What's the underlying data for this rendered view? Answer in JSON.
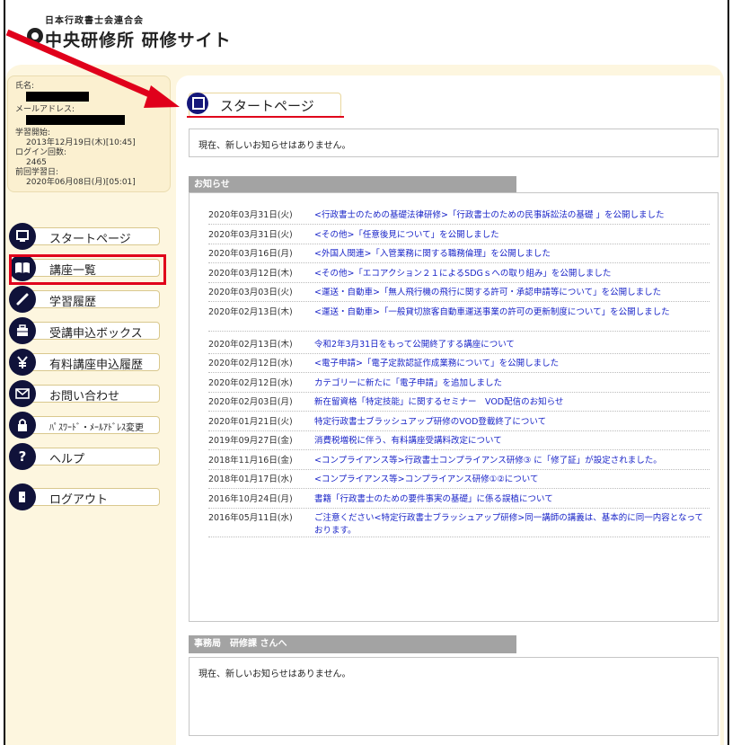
{
  "header": {
    "association": "日本行政書士会連合会",
    "site_title": "中央研修所 研修サイト"
  },
  "user": {
    "name_label": "氏名:",
    "email_label": "メールアドレス:",
    "start_label": "学習開始:",
    "start_value": "2013年12月19日(木)[10:45]",
    "login_count_label": "ログイン回数:",
    "login_count_value": "2465",
    "last_study_label": "前回学習日:",
    "last_study_value": "2020年06月08日(月)[05:01]"
  },
  "nav": [
    {
      "label": "スタートページ",
      "icon": "monitor-icon"
    },
    {
      "label": "講座一覧",
      "icon": "book-icon"
    },
    {
      "label": "学習履歴",
      "icon": "pencil-icon"
    },
    {
      "label": "受講申込ボックス",
      "icon": "briefcase-icon"
    },
    {
      "label": "有料講座申込履歴",
      "icon": "yen-icon"
    },
    {
      "label": "お問い合わせ",
      "icon": "mail-icon"
    },
    {
      "label": "ﾊﾟｽﾜｰﾄﾞ・ﾒｰﾙｱﾄﾞﾚｽ変更",
      "icon": "lock-icon"
    },
    {
      "label": "ヘルプ",
      "icon": "question-icon"
    },
    {
      "label": "ログアウト",
      "icon": "exit-icon"
    }
  ],
  "page": {
    "heading": "スタートページ",
    "top_notice": "現在、新しいお知らせはありません。",
    "news_header": "お知らせ",
    "office_header": "事務局　研修課 さんへ",
    "office_notice": "現在、新しいお知らせはありません。"
  },
  "news": [
    {
      "date": "2020年03月31日(火)",
      "title": "<行政書士のための基礎法律研修>「行政書士のための民事訴訟法の基礎 」を公開しました"
    },
    {
      "date": "2020年03月31日(火)",
      "title": "<その他>「任意後見について」を公開しました"
    },
    {
      "date": "2020年03月16日(月)",
      "title": "<外国人関連>「入管業務に関する職務倫理」を公開しました"
    },
    {
      "date": "2020年03月12日(木)",
      "title": "<その他>「エコアクション２１によるSDGｓへの取り組み」を公開しました"
    },
    {
      "date": "2020年03月03日(火)",
      "title": "<運送・自動車>「無人飛行機の飛行に関する許可・承認申請等について」を公開しました"
    },
    {
      "date": "2020年02月13日(木)",
      "title": "<運送・自動車>「一般貸切旅客自動車運送事業の許可の更新制度について」を公開しました"
    },
    {
      "date": "2020年02月13日(木)",
      "title": "令和2年3月31日をもって公開終了する講座について"
    },
    {
      "date": "2020年02月12日(水)",
      "title": "<電子申請>「電子定款認証作成業務について」を公開しました"
    },
    {
      "date": "2020年02月12日(水)",
      "title": "カテゴリーに新たに「電子申請」を追加しました"
    },
    {
      "date": "2020年02月03日(月)",
      "title": "新在留資格「特定技能」に関するセミナー　VOD配信のお知らせ"
    },
    {
      "date": "2020年01月21日(火)",
      "title": "特定行政書士ブラッシュアップ研修のVOD登載終了について"
    },
    {
      "date": "2019年09月27日(金)",
      "title": "消費税増税に伴う、有料講座受講料改定について"
    },
    {
      "date": "2018年11月16日(金)",
      "title": "<コンプライアンス等>行政書士コンプライアンス研修③ に「修了証」が設定されました。"
    },
    {
      "date": "2018年01月17日(水)",
      "title": "<コンプライアンス等>コンプライアンス研修①②について"
    },
    {
      "date": "2016年10月24日(月)",
      "title": "書籍「行政書士のための要件事実の基礎」に係る誤植について"
    },
    {
      "date": "2016年05月11日(水)",
      "title": "ご注意ください<特定行政書士ブラッシュアップ研修>同一講師の講義は、基本的に同一内容となっております。"
    }
  ],
  "colors": {
    "accent_red": "#e0001b",
    "nav_icon": "#10123a",
    "link": "#1a25c8",
    "cream": "#fdf6df",
    "section_bar": "#a3a3a3"
  }
}
